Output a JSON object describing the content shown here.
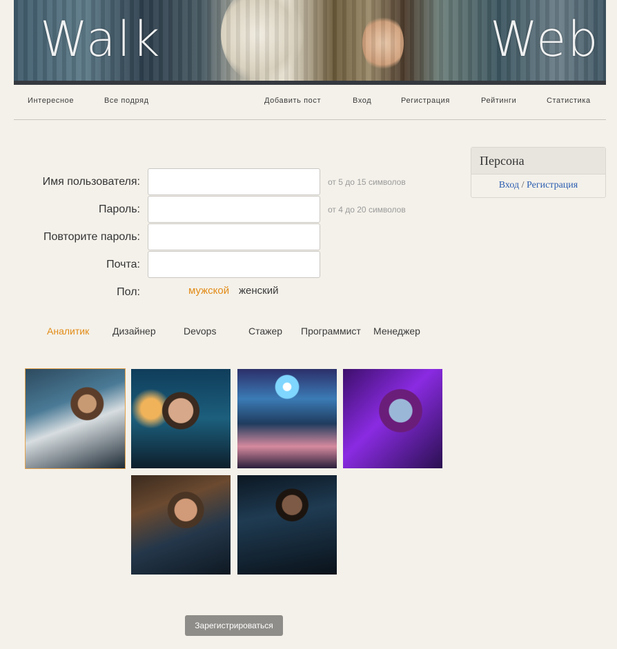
{
  "banner": {
    "title_left": "Walk",
    "title_right": "Web"
  },
  "nav": {
    "items": [
      "Интересное",
      "Все подряд",
      "Добавить пост",
      "Вход",
      "Регистрация",
      "Рейтинги",
      "Статистика"
    ]
  },
  "form": {
    "username_label": "Имя пользователя:",
    "username_hint": "от 5 до 15 символов",
    "password_label": "Пароль:",
    "password_hint": "от 4 до 20 символов",
    "repeat_label": "Повторите пароль:",
    "email_label": "Почта:",
    "gender_label": "Пол:",
    "gender_options": [
      "мужской",
      "женский"
    ],
    "gender_selected": "мужской",
    "submit_label": "Зарегистрироваться"
  },
  "classes": {
    "items": [
      "Аналитик",
      "Дизайнер",
      "Devops",
      "Стажер",
      "Программист",
      "Менеджер"
    ],
    "selected": "Аналитик"
  },
  "avatars": {
    "count": 6,
    "selected_index": 0
  },
  "sidebar": {
    "title": "Персона",
    "login": "Вход",
    "separator": "/",
    "register": "Регистрация"
  },
  "colors": {
    "accent": "#e28b17",
    "background": "#f4f1ea",
    "link": "#2a5db0",
    "button": "#8f8d89"
  }
}
